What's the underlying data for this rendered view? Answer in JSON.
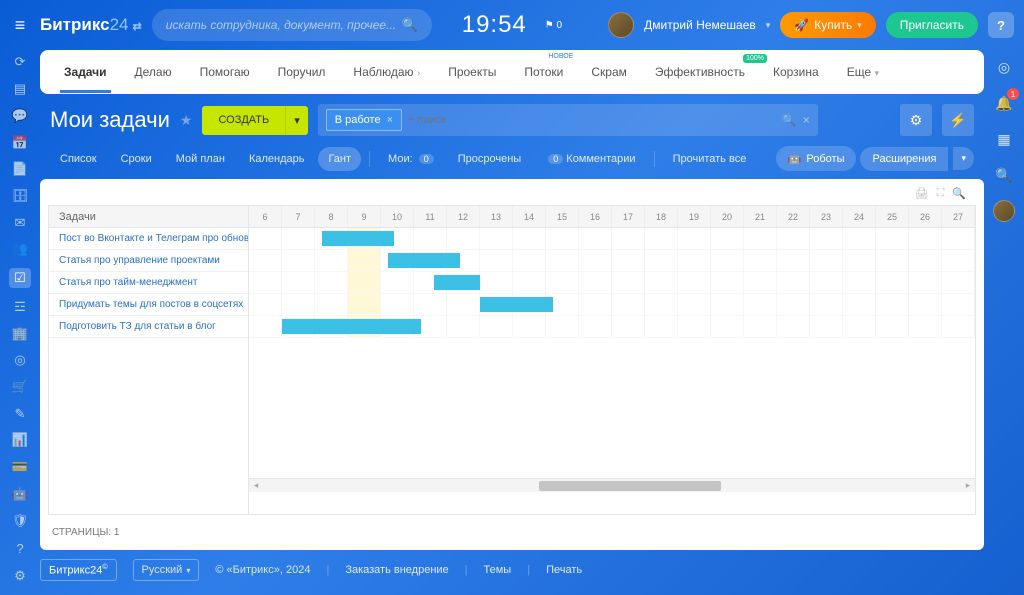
{
  "header": {
    "logo_text": "Битрикс",
    "logo_num": "24",
    "search_placeholder": "искать сотрудника, документ, прочее...",
    "clock": "19:54",
    "flag": "⚑ 0",
    "user_name": "Дмитрий Немешаев",
    "buy": "Купить",
    "invite": "Пригласить",
    "help": "?"
  },
  "notif_badge": "1",
  "tabs": {
    "t1": "Задачи",
    "t2": "Делаю",
    "t3": "Помогаю",
    "t4": "Поручил",
    "t5": "Наблюдаю",
    "t6": "Проекты",
    "t7": "Потоки",
    "t7_sup": "новое",
    "t8": "Скрам",
    "t9": "Эффективность",
    "t9_sup": "100%",
    "t10": "Корзина",
    "t11": "Еще"
  },
  "title": {
    "text": "Мои задачи",
    "create": "СОЗДАТЬ",
    "filter_tag": "В работе",
    "filter_placeholder": "+ поиск"
  },
  "views": {
    "v1": "Список",
    "v2": "Сроки",
    "v3": "Мой план",
    "v4": "Календарь",
    "v5": "Гант",
    "mine": "Мои:",
    "c0": "0",
    "overdue": "Просрочены",
    "comments": "Комментарии",
    "readall": "Прочитать все",
    "robots": "Роботы",
    "ext": "Расширения"
  },
  "gantt": {
    "left_header": "Задачи",
    "pager": "СТРАНИЦЫ: 1",
    "days": [
      "6",
      "7",
      "8",
      "9",
      "10",
      "11",
      "12",
      "13",
      "14",
      "15",
      "16",
      "17",
      "18",
      "19",
      "20",
      "21",
      "22",
      "23",
      "24",
      "25",
      "26",
      "27"
    ],
    "rows": [
      {
        "label": "Пост во Вконтакте и Телеграм про обновление",
        "start": 2.2,
        "span": 2.2
      },
      {
        "label": "Статья про управление проектами",
        "start": 4.2,
        "span": 2.2
      },
      {
        "label": "Статья про тайм-менеджмент",
        "start": 5.6,
        "span": 1.4
      },
      {
        "label": "Придумать темы для постов в соцсетях",
        "start": 7.0,
        "span": 2.2
      },
      {
        "label": "Подготовить ТЗ для статьи в блог",
        "start": 1.0,
        "span": 4.2
      }
    ],
    "today_index": 3
  },
  "footer": {
    "logo": "Битрикс24",
    "lang": "Русский",
    "copy": "© «Битрикс», 2024",
    "l1": "Заказать внедрение",
    "l2": "Темы",
    "l3": "Печать"
  }
}
